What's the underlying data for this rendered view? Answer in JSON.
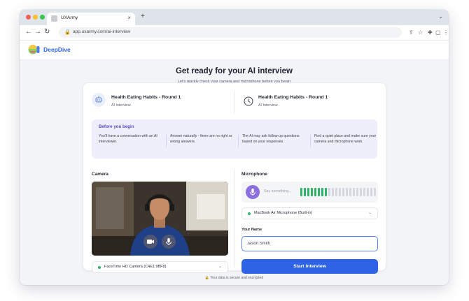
{
  "browser": {
    "tab_title": "UXArmy",
    "tab_close": "×",
    "new_tab": "+",
    "url": "app.uxarmy.com/ai-interview"
  },
  "app": {
    "brand": "DeepDive",
    "logo_colors": [
      "#7ed957",
      "#f7c843",
      "#f25f8b",
      "#4f7ef7"
    ]
  },
  "page": {
    "title": "Get ready for your AI interview",
    "subtitle": "Let's quickly check your camera and microphone before you begin"
  },
  "interview": [
    {
      "title": "Health Eating Habits - Round 1",
      "type": "AI Interview",
      "icon": "chat-bot-icon"
    },
    {
      "title": "Health Eating Habits - Round 1",
      "type": "AI Interview",
      "icon": "clock-icon"
    }
  ],
  "tips": {
    "title": "Before you begin",
    "items": [
      "You'll have a conversation with an AI interviewer.",
      "Answer naturally - there are no right or wrong answers.",
      "The AI may ask follow-up questions based on your responses.",
      "Find a quiet place and make sure your camera and microphone work."
    ]
  },
  "camera": {
    "label": "Camera",
    "device": "FaceTime HD Camera (C4E1:9BF8)"
  },
  "microphone": {
    "label": "Microphone",
    "placeholder": "Say something...",
    "device": "MacBook Air Microphone (Built-in)",
    "level_active": 8,
    "level_total": 22
  },
  "form": {
    "name_label": "Your Name",
    "name_value": "Jason Smith",
    "start_label": "Start Interview"
  },
  "footer": {
    "secure_text": "Your data is secure and encrypted"
  },
  "colors": {
    "accent": "#2e63e6",
    "tips_bg": "#efeefb",
    "tips_title": "#5b4bc7",
    "level_on": "#2fb26a",
    "level_off": "#d5d8de",
    "status": "#2fb26a"
  }
}
